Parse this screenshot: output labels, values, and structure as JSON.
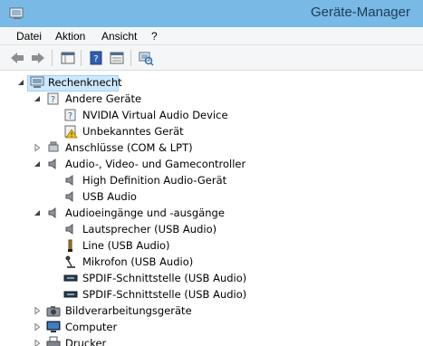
{
  "window": {
    "title": "Geräte-Manager"
  },
  "menu": [
    "Datei",
    "Aktion",
    "Ansicht",
    "?"
  ],
  "toolbar": {
    "buttons": [
      "back-arrow-icon",
      "forward-arrow-icon",
      "properties-grid-icon",
      "help-icon",
      "details-view-icon",
      "scan-hardware-icon"
    ]
  },
  "tree": {
    "root": "Rechenknecht",
    "nodes": [
      {
        "label": "Andere Geräte",
        "expanded": true
      },
      {
        "label": "NVIDIA Virtual Audio Device"
      },
      {
        "label": "Unbekanntes Gerät"
      },
      {
        "label": "Anschlüsse (COM & LPT)",
        "expanded": false
      },
      {
        "label": "Audio-, Video- und Gamecontroller",
        "expanded": true
      },
      {
        "label": "High Definition Audio-Gerät"
      },
      {
        "label": "USB Audio"
      },
      {
        "label": "Audioeingänge und -ausgänge",
        "expanded": true
      },
      {
        "label": "Lautsprecher (USB Audio)"
      },
      {
        "label": "Line (USB Audio)"
      },
      {
        "label": "Mikrofon (USB Audio)"
      },
      {
        "label": "SPDIF-Schnittstelle (USB Audio)"
      },
      {
        "label": "SPDIF-Schnittstelle (USB Audio)"
      },
      {
        "label": "Bildverarbeitungsgeräte",
        "expanded": false
      },
      {
        "label": "Computer",
        "expanded": false
      },
      {
        "label": "Drucker",
        "expanded": false
      }
    ]
  }
}
